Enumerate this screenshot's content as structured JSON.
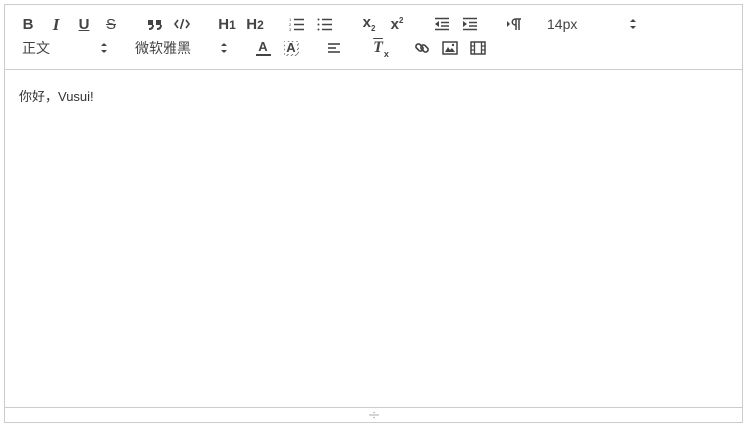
{
  "toolbar": {
    "size_picker": {
      "value": "14px"
    },
    "header_picker": {
      "value": "正文"
    },
    "font_picker": {
      "value": "微软雅黑"
    },
    "buttons": {
      "bold": "B",
      "italic": "I",
      "underline": "U",
      "strike": "S",
      "header1_letter": "H",
      "header1_num": "1",
      "header2_letter": "H",
      "header2_num": "2",
      "sub_x": "x",
      "sub_n": "2",
      "sup_x": "x",
      "sup_n": "2",
      "text_color": "A",
      "background": "A",
      "clean": "T"
    }
  },
  "editor": {
    "content": "你好，Vusui!"
  },
  "colors": {
    "border": "#cccccc",
    "icon": "#444444"
  }
}
